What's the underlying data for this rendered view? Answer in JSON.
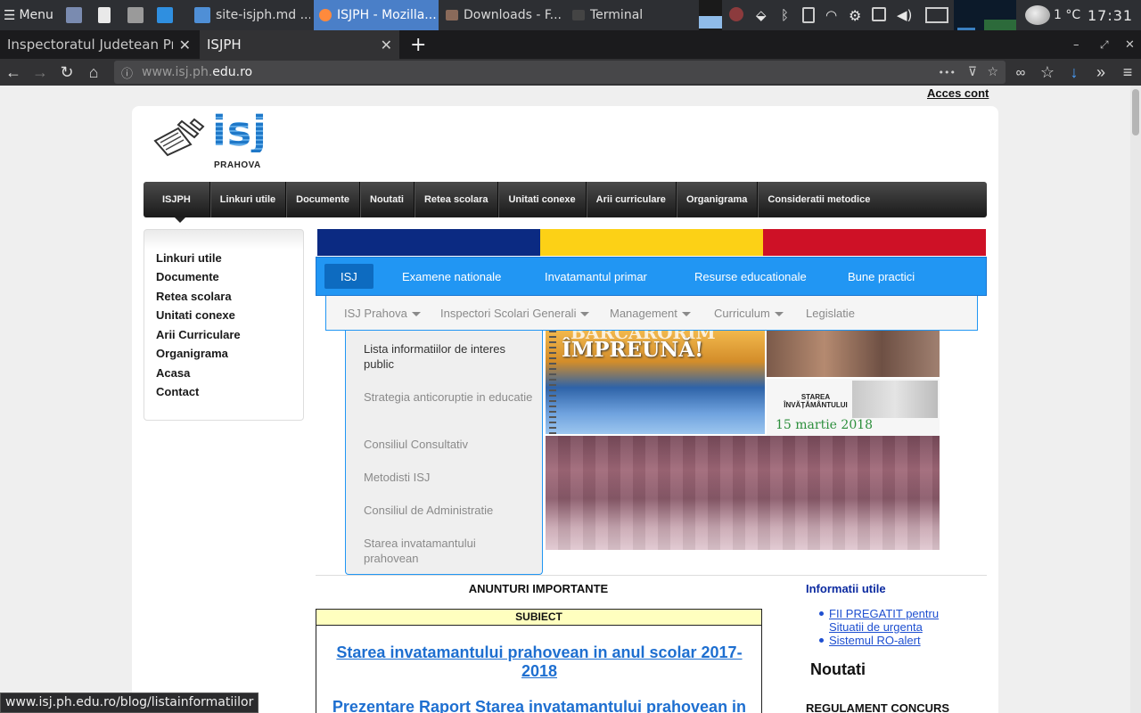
{
  "taskbar": {
    "menu_label": "Menu",
    "tasks": [
      {
        "label": "site-isjph.md ...",
        "icon": "text-editor-icon"
      },
      {
        "label": "ISJPH - Mozilla...",
        "icon": "firefox-icon",
        "active": true
      },
      {
        "label": "Downloads - F...",
        "icon": "folder-icon"
      },
      {
        "label": "Terminal",
        "icon": "terminal-icon"
      }
    ],
    "weather": "1 °C",
    "clock": "17:31"
  },
  "browser": {
    "tabs": [
      {
        "label": "Inspectoratul Judetean Prah"
      },
      {
        "label": "ISJPH",
        "active": true
      }
    ],
    "new_tab": "+",
    "url_prefix": "www.isj.ph.",
    "url_domain": "edu.ro",
    "more": "•••"
  },
  "page": {
    "acces_cont": "Acces cont",
    "logo": {
      "text": "isj",
      "sub": "PRAHOVA"
    },
    "main_nav": [
      "ISJPH",
      "Linkuri utile",
      "Documente",
      "Noutati",
      "Retea scolara",
      "Unitati conexe",
      "Arii curriculare",
      "Organigrama",
      "Consideratii metodice"
    ],
    "sidebar": [
      "Linkuri utile",
      "Documente",
      "Retea scolara",
      "Unitati conexe",
      "Arii Curriculare",
      "Organigrama",
      "Acasa",
      "Contact"
    ],
    "flag_colors": [
      "#0b2a82",
      "#fcd116",
      "#ce1126"
    ],
    "blue_nav": [
      "ISJ",
      "Examene nationale",
      "Invatamantul primar",
      "Resurse educationale",
      "Bune practici"
    ],
    "sub_nav": [
      {
        "label": "ISJ Prahova",
        "caret": true
      },
      {
        "label": "Inspectori Scolari Generali",
        "caret": true
      },
      {
        "label": "Management",
        "caret": true
      },
      {
        "label": "Curriculum",
        "caret": true
      },
      {
        "label": "Legislatie",
        "caret": false
      }
    ],
    "dropdown": [
      "Lista informatiilor de interes public",
      "Strategia anticoruptie in educatie",
      "Consiliul Consultativ",
      "Metodisti ISJ",
      "Consiliul de Administratie",
      "Starea invatamantului prahovean"
    ],
    "banner": {
      "headline_top": "BARCARORIM",
      "headline": "ÎMPREUNĂ!",
      "report_title": "STAREA ÎNVĂȚĂMÂNTULUI",
      "report_date": "15 martie 2018"
    },
    "anunturi_title": "ANUNTURI IMPORTANTE",
    "subiect_header": "SUBIECT",
    "announcements": [
      "Starea invatamantului prahovean in anul scolar 2017-2018",
      "Prezentare Raport Starea invatamantului prahovean in"
    ],
    "info_title": "Informatii utile",
    "info_links": [
      "FII PREGATIT pentru Situatii de urgenta",
      "Sistemul RO-alert"
    ],
    "noutati": "Noutati",
    "regulament": "REGULAMENT CONCURS"
  },
  "status_url": "www.isj.ph.edu.ro/blog/listainformatiilor"
}
